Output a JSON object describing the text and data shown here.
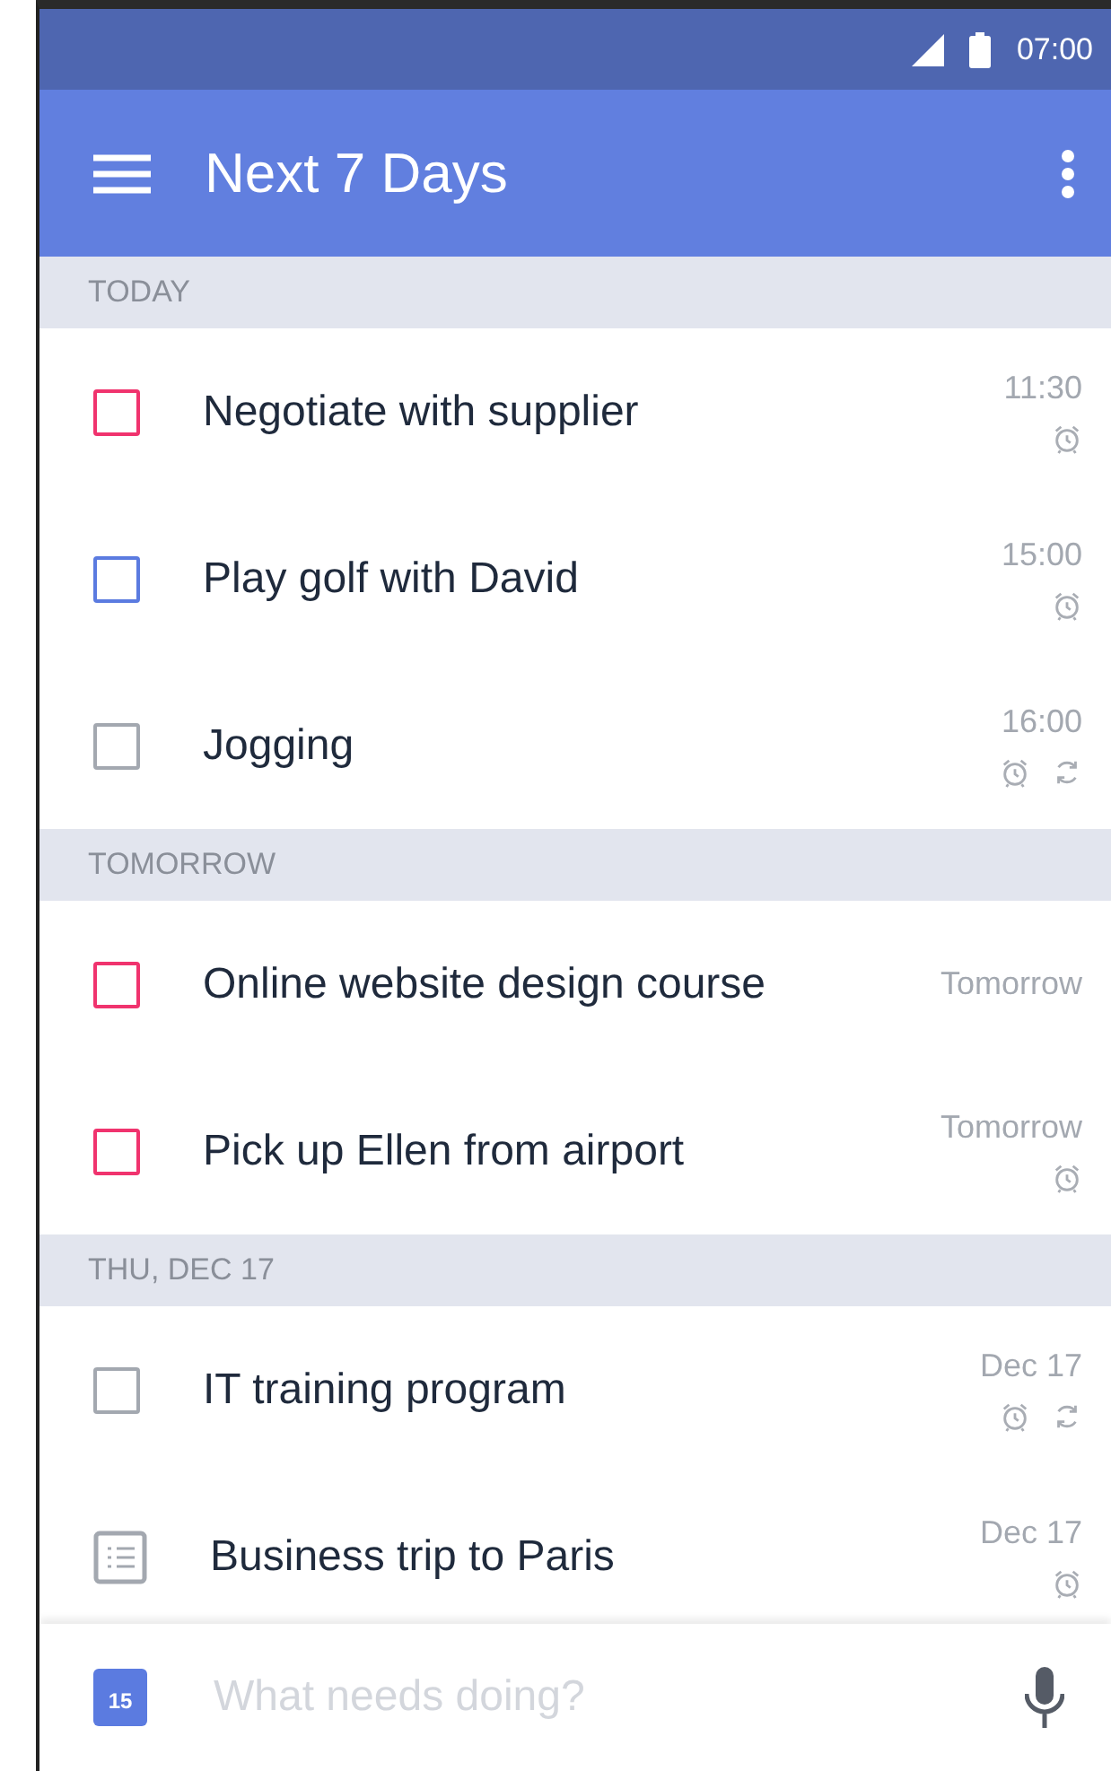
{
  "status_bar": {
    "time": "07:00"
  },
  "app_bar": {
    "title": "Next 7 Days"
  },
  "sections": [
    {
      "header": "TODAY",
      "tasks": [
        {
          "kind": "task",
          "title": "Negotiate with supplier",
          "due": "11:30",
          "color": "#f0336e",
          "alarm": true,
          "repeat": false
        },
        {
          "kind": "task",
          "title": "Play golf with David",
          "due": "15:00",
          "color": "#5b7be0",
          "alarm": true,
          "repeat": false
        },
        {
          "kind": "task",
          "title": "Jogging",
          "due": "16:00",
          "color": "#a3a8b0",
          "alarm": true,
          "repeat": true
        }
      ]
    },
    {
      "header": "TOMORROW",
      "tasks": [
        {
          "kind": "task",
          "title": "Online website design course",
          "due": "Tomorrow",
          "color": "#f0336e",
          "alarm": false,
          "repeat": false
        },
        {
          "kind": "task",
          "title": "Pick up Ellen from airport",
          "due": "Tomorrow",
          "color": "#f0336e",
          "alarm": true,
          "repeat": false
        }
      ]
    },
    {
      "header": "THU, DEC 17",
      "tasks": [
        {
          "kind": "task",
          "title": "IT training program",
          "due": "Dec 17",
          "color": "#a3a8b0",
          "alarm": true,
          "repeat": true
        },
        {
          "kind": "note",
          "title": "Business trip to Paris",
          "due": "Dec 17",
          "color": "#a3a8b0",
          "alarm": true,
          "repeat": false
        }
      ]
    }
  ],
  "quick_add": {
    "calendar_day": "15",
    "placeholder": "What needs doing?"
  }
}
